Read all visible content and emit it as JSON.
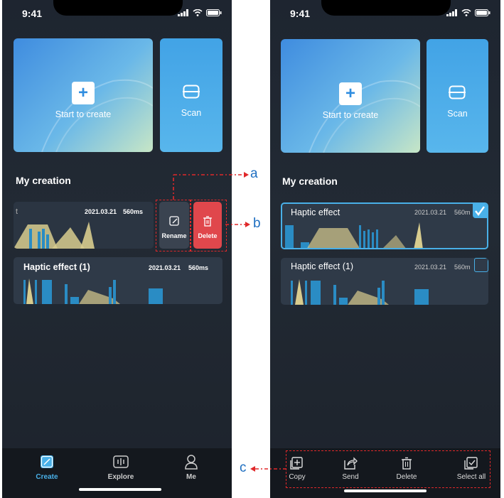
{
  "status": {
    "time": "9:41"
  },
  "home": {
    "create_label": "Start to create",
    "scan_label": "Scan",
    "section_title": "My creation"
  },
  "left_list": [
    {
      "title": "t",
      "date": "2021.03.21",
      "duration": "560ms"
    },
    {
      "title": "Haptic effect (1)",
      "date": "2021.03.21",
      "duration": "560ms"
    }
  ],
  "swipe_actions": {
    "rename": "Rename",
    "delete": "Delete"
  },
  "tabs": [
    {
      "label": "Create",
      "icon": "create-icon",
      "active": true
    },
    {
      "label": "Explore",
      "icon": "explore-icon",
      "active": false
    },
    {
      "label": "Me",
      "icon": "person-icon",
      "active": false
    }
  ],
  "right_list": [
    {
      "title": "Haptic effect",
      "date": "2021.03.21",
      "duration": "560m",
      "checked": true
    },
    {
      "title": "Haptic effect (1)",
      "date": "2021.03.21",
      "duration": "560m",
      "checked": false
    }
  ],
  "bulk_actions": [
    {
      "label": "Copy",
      "icon": "copy-icon"
    },
    {
      "label": "Send",
      "icon": "send-icon"
    },
    {
      "label": "Delete",
      "icon": "trash-icon"
    },
    {
      "label": "Select all",
      "icon": "select-all-icon"
    }
  ],
  "annotations": {
    "a": "a",
    "b": "b",
    "c": "c"
  },
  "colors": {
    "accent": "#3fa8e6",
    "delete": "#e0474c",
    "annotation": "#1f6fc1",
    "highlight": "#e0282a"
  }
}
